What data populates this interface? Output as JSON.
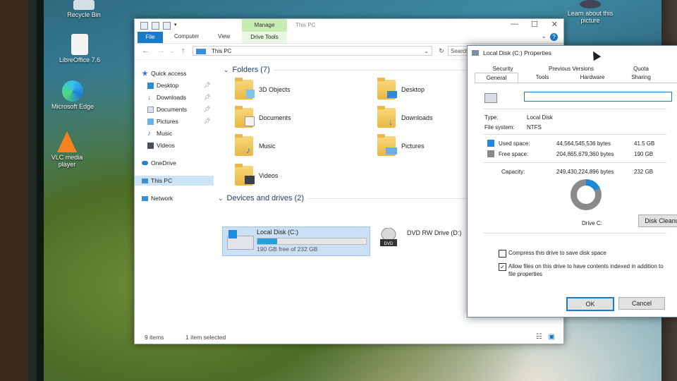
{
  "desktop_icons": [
    {
      "label": "Recycle Bin"
    },
    {
      "label": "LibreOffice 7.6"
    },
    {
      "label": "Microsoft Edge"
    },
    {
      "label": "VLC media player"
    },
    {
      "label": "Learn about this picture"
    }
  ],
  "explorer": {
    "title": "This PC",
    "manage_tab": "Manage",
    "ribbon_tabs": [
      "File",
      "Computer",
      "View",
      "Drive Tools"
    ],
    "address": "This PC",
    "search_placeholder": "Search This PC",
    "nav": [
      {
        "label": "Quick access",
        "pinned": false,
        "icon": "star-icon"
      },
      {
        "label": "Desktop",
        "pinned": true,
        "icon": "desktop-icon"
      },
      {
        "label": "Downloads",
        "pinned": true,
        "icon": "download-icon"
      },
      {
        "label": "Documents",
        "pinned": true,
        "icon": "documents-icon"
      },
      {
        "label": "Pictures",
        "pinned": true,
        "icon": "pictures-icon"
      },
      {
        "label": "Music",
        "pinned": false,
        "icon": "music-icon"
      },
      {
        "label": "Videos",
        "pinned": false,
        "icon": "videos-icon"
      },
      {
        "label": "OneDrive",
        "pinned": false,
        "icon": "cloud-icon"
      },
      {
        "label": "This PC",
        "pinned": false,
        "icon": "computer-icon",
        "selected": true
      },
      {
        "label": "Network",
        "pinned": false,
        "icon": "network-icon"
      }
    ],
    "folders_header": "Folders (7)",
    "folders": [
      "3D Objects",
      "Desktop",
      "Documents",
      "Downloads",
      "Music",
      "Pictures",
      "Videos"
    ],
    "drives_header": "Devices and drives (2)",
    "drives": [
      {
        "name": "Local Disk (C:)",
        "free_text": "190 GB free of 232 GB",
        "used_fraction": 0.18
      },
      {
        "name": "DVD RW Drive (D:)",
        "label": "DVD"
      }
    ],
    "status_items": "9 items",
    "status_selected": "1 item selected"
  },
  "properties": {
    "title": "Local Disk (C:) Properties",
    "tabs_top": [
      "Security",
      "Previous Versions",
      "Quota"
    ],
    "tabs_bottom": [
      "General",
      "Tools",
      "Hardware",
      "Sharing"
    ],
    "active_tab": "General",
    "name_value": "",
    "type_label": "Type:",
    "type_value": "Local Disk",
    "fs_label": "File system:",
    "fs_value": "NTFS",
    "used_label": "Used space:",
    "used_bytes": "44,564,545,536 bytes",
    "used_gb": "41.5 GB",
    "free_label": "Free space:",
    "free_bytes": "204,865,679,360 bytes",
    "free_gb": "190 GB",
    "capacity_label": "Capacity:",
    "capacity_bytes": "249,430,224,896 bytes",
    "capacity_gb": "232 GB",
    "used_fraction": 0.18,
    "used_color": "#1f88d8",
    "free_color": "#8a8a8a",
    "drive_label": "Drive C:",
    "cleanup_button": "Disk Cleanup",
    "compress_label": "Compress this drive to save disk space",
    "compress_checked": false,
    "index_label_1": "Allow files on this drive to have contents indexed in addition to",
    "index_label_2": "file properties",
    "index_checked": true,
    "ok": "OK",
    "cancel": "Cancel"
  }
}
